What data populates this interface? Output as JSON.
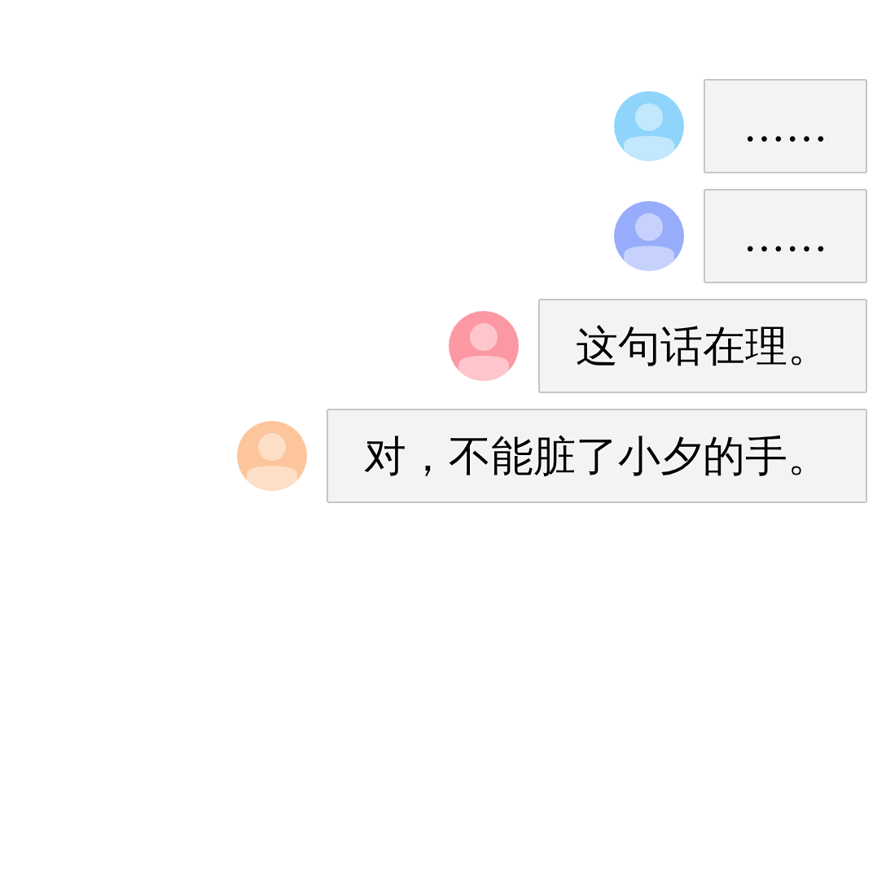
{
  "messages": [
    {
      "text": "……",
      "color": "#8fd5fb"
    },
    {
      "text": "……",
      "color": "#97adfb"
    },
    {
      "text": "这句话在理。",
      "color": "#fb98a3"
    },
    {
      "text": "对，不能脏了小夕的手。",
      "color": "#fcc59b"
    }
  ]
}
